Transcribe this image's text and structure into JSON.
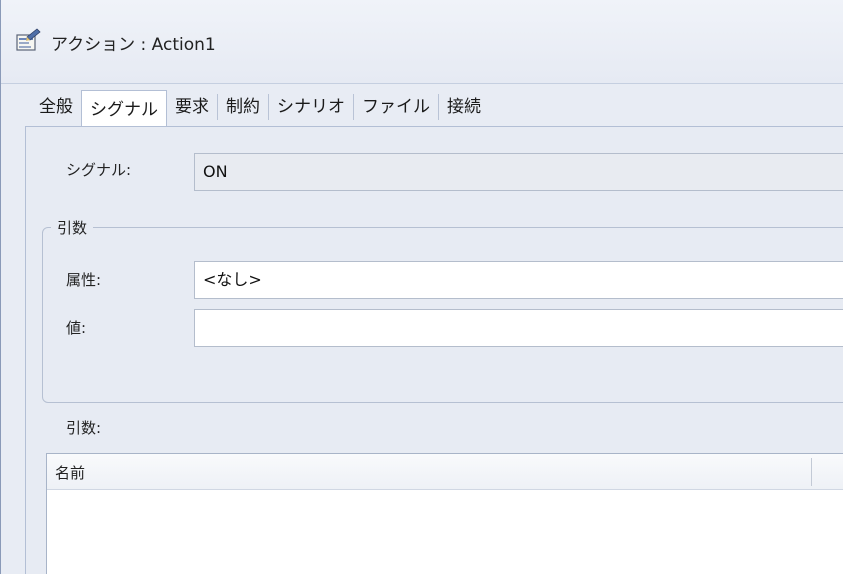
{
  "window": {
    "title": "アクション : Action1",
    "icon": "properties-icon"
  },
  "tabs": [
    {
      "label": "全般",
      "active": false
    },
    {
      "label": "シグナル",
      "active": true
    },
    {
      "label": "要求",
      "active": false
    },
    {
      "label": "制約",
      "active": false
    },
    {
      "label": "シナリオ",
      "active": false
    },
    {
      "label": "ファイル",
      "active": false
    },
    {
      "label": "接続",
      "active": false
    }
  ],
  "signal": {
    "label": "シグナル:",
    "value": "ON"
  },
  "arguments_group": {
    "legend": "引数",
    "attribute_label": "属性:",
    "attribute_value": "<なし>",
    "value_label": "値:",
    "value_value": ""
  },
  "arguments_list": {
    "label": "引数:",
    "columns": [
      "名前"
    ],
    "rows": []
  }
}
